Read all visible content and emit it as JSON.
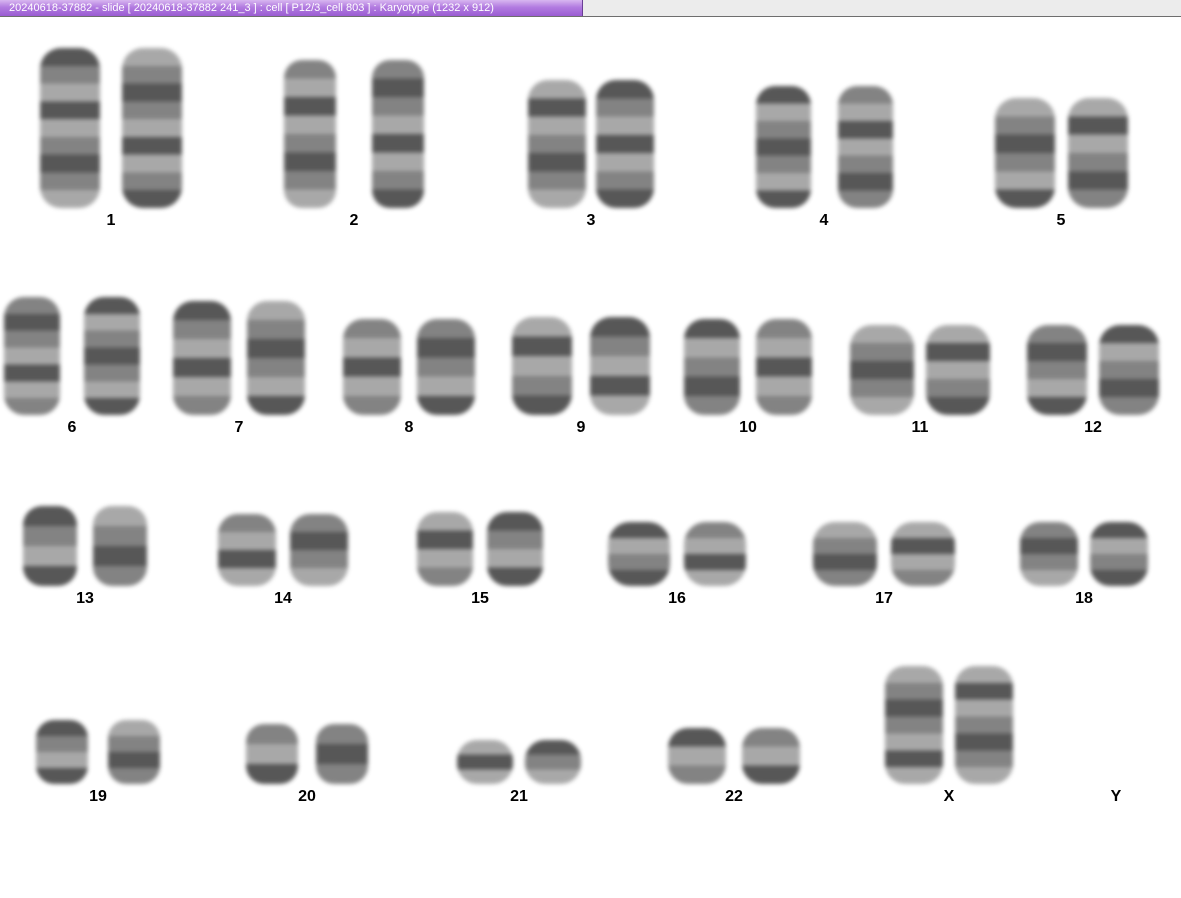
{
  "window": {
    "title": "20240618-37882 - slide [ 20240618-37882 241_3 ] : cell [ P12/3_cell 803 ] : Karyotype  (1232 x 912)",
    "title_color": "#b27be0"
  },
  "karyotype": {
    "chromosomes": [
      {
        "label": "1",
        "copies": 2
      },
      {
        "label": "2",
        "copies": 2
      },
      {
        "label": "3",
        "copies": 2
      },
      {
        "label": "4",
        "copies": 2
      },
      {
        "label": "5",
        "copies": 2
      },
      {
        "label": "6",
        "copies": 2
      },
      {
        "label": "7",
        "copies": 2
      },
      {
        "label": "8",
        "copies": 2
      },
      {
        "label": "9",
        "copies": 2
      },
      {
        "label": "10",
        "copies": 2
      },
      {
        "label": "11",
        "copies": 2
      },
      {
        "label": "12",
        "copies": 2
      },
      {
        "label": "13",
        "copies": 2
      },
      {
        "label": "14",
        "copies": 2
      },
      {
        "label": "15",
        "copies": 2
      },
      {
        "label": "16",
        "copies": 2
      },
      {
        "label": "17",
        "copies": 2
      },
      {
        "label": "18",
        "copies": 2
      },
      {
        "label": "19",
        "copies": 2
      },
      {
        "label": "20",
        "copies": 2
      },
      {
        "label": "21",
        "copies": 2
      },
      {
        "label": "22",
        "copies": 2
      },
      {
        "label": "X",
        "copies": 2
      },
      {
        "label": "Y",
        "copies": 0
      }
    ]
  }
}
